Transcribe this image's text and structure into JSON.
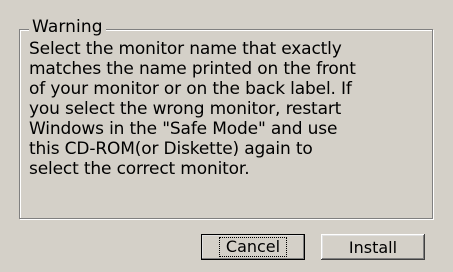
{
  "dialog": {
    "group_title": "Warning",
    "message_lines": [
      "Select the monitor name that exactly",
      "matches the name printed on the front",
      "of your monitor or on the back label. If",
      "you select the wrong monitor, restart",
      "Windows in the \"Safe Mode\" and use",
      "this CD-ROM(or Diskette) again to",
      "select the correct monitor."
    ]
  },
  "buttons": {
    "cancel_label": "Cancel",
    "install_label": "Install"
  }
}
